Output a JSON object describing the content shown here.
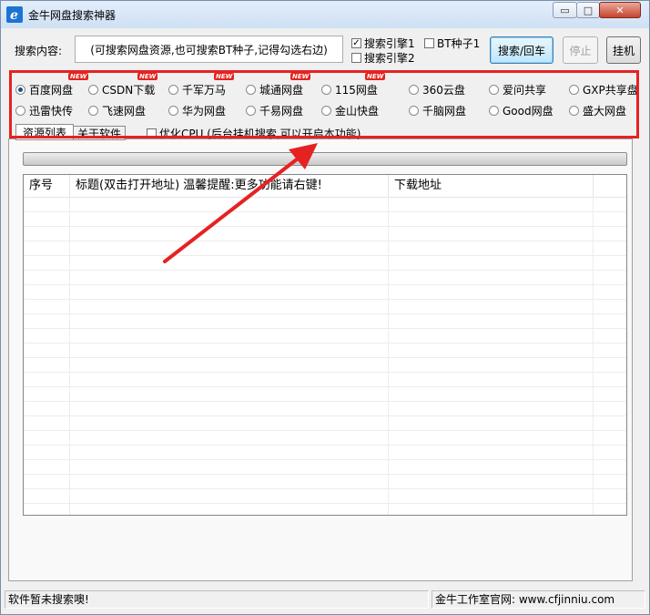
{
  "window": {
    "title": "金牛网盘搜索神器"
  },
  "caption_buttons": {
    "minimize": "▭",
    "maximize": "□",
    "close": "✕"
  },
  "search": {
    "label": "搜索内容:",
    "value": "(可搜索网盘资源,也可搜索BT种子,记得勾选右边)"
  },
  "engines": [
    {
      "label": "搜索引擎1",
      "checked": true
    },
    {
      "label": "搜索引擎2",
      "checked": false
    },
    {
      "label": "BT种子1",
      "checked": false
    }
  ],
  "buttons": {
    "search": "搜索/回车",
    "stop": "停止",
    "hang": "挂机"
  },
  "new_badge": "NEW",
  "sources": [
    {
      "label": "百度网盘",
      "selected": true,
      "new": true
    },
    {
      "label": "CSDN下载",
      "selected": false,
      "new": true
    },
    {
      "label": "千军万马",
      "selected": false,
      "new": true
    },
    {
      "label": "城通网盘",
      "selected": false,
      "new": true
    },
    {
      "label": "115网盘",
      "selected": false,
      "new": true
    },
    {
      "label": "360云盘",
      "selected": false,
      "new": false
    },
    {
      "label": "爱问共享",
      "selected": false,
      "new": false
    },
    {
      "label": "GXP共享盘",
      "selected": false,
      "new": false
    },
    {
      "label": "迅雷快传",
      "selected": false,
      "new": false
    },
    {
      "label": "飞速网盘",
      "selected": false,
      "new": false
    },
    {
      "label": "华为网盘",
      "selected": false,
      "new": false
    },
    {
      "label": "千易网盘",
      "selected": false,
      "new": false
    },
    {
      "label": "金山快盘",
      "selected": false,
      "new": false
    },
    {
      "label": "千脑网盘",
      "selected": false,
      "new": false
    },
    {
      "label": "Good网盘",
      "selected": false,
      "new": false
    },
    {
      "label": "盛大网盘",
      "selected": false,
      "new": false
    }
  ],
  "tabs": [
    "资源列表",
    "关于软件"
  ],
  "optimize_cpu": {
    "label": "优化CPU (后台挂机搜索,可以开启本功能)",
    "checked": false
  },
  "columns": [
    "序号",
    "标题(双击打开地址) 温馨提醒:更多功能请右键!",
    "下载地址"
  ],
  "status": {
    "left": "软件暂未搜索噢!",
    "right": "金牛工作室官网: www.cfjinniu.com"
  },
  "colors": {
    "highlight": "#e52222",
    "arrow": "#e52222"
  }
}
